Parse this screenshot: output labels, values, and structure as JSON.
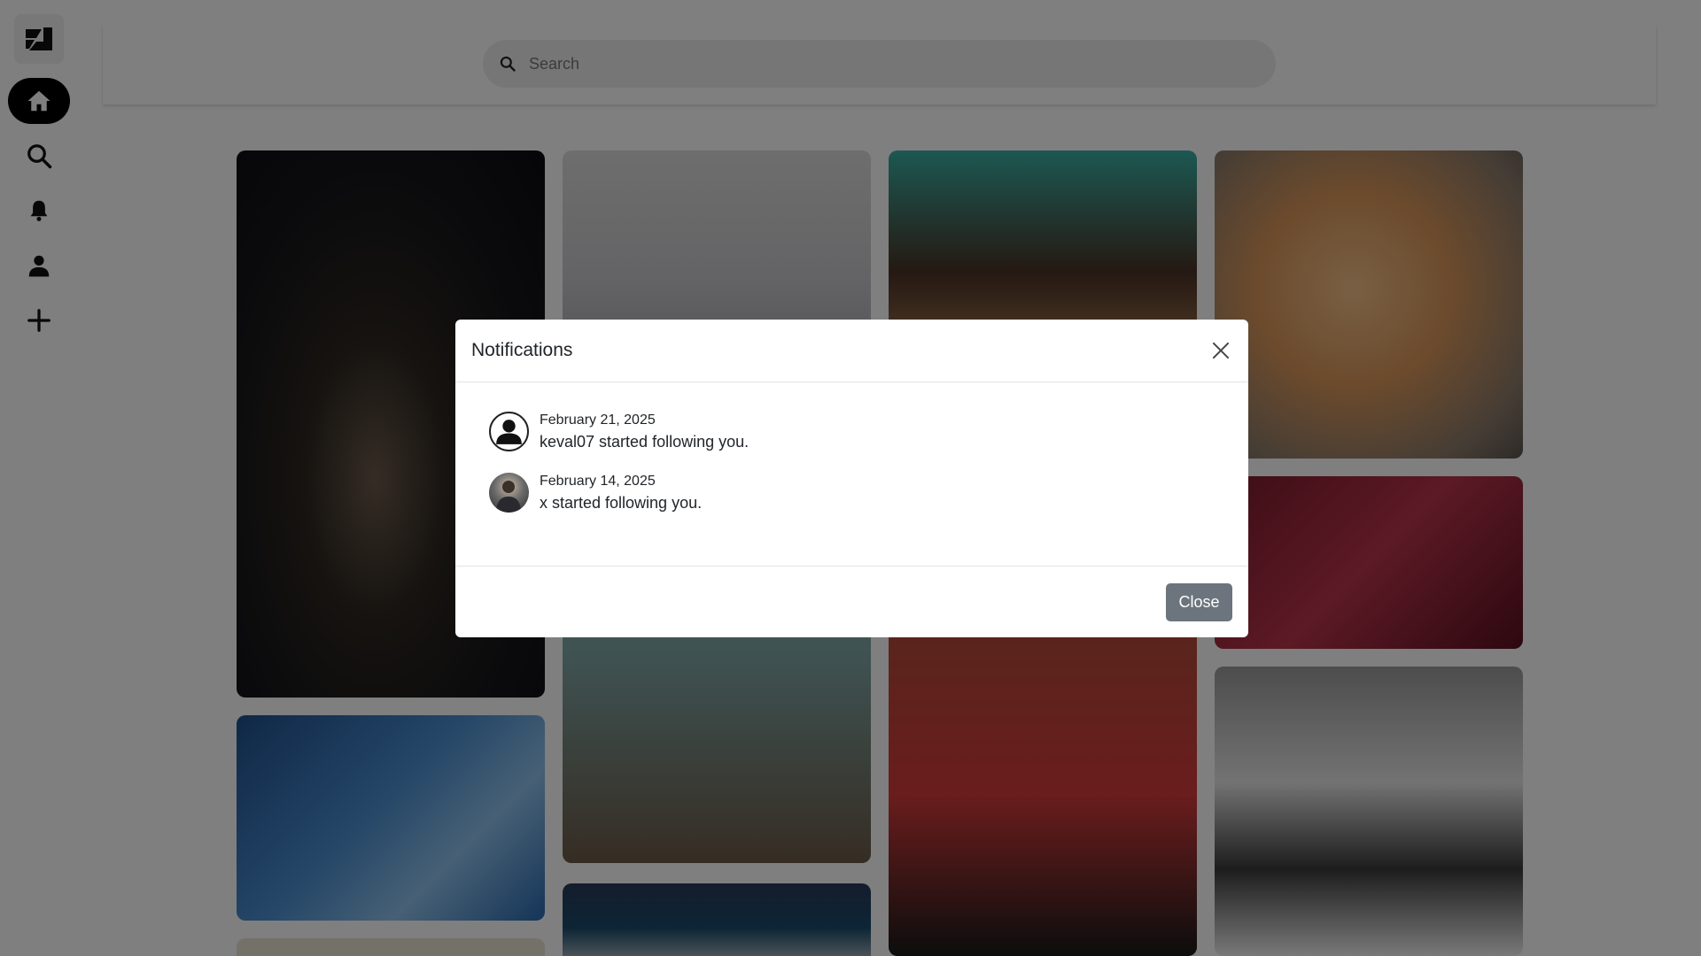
{
  "search": {
    "placeholder": "Search"
  },
  "sidebar": {
    "items": [
      {
        "name": "home",
        "icon": "home-icon",
        "active": true
      },
      {
        "name": "search",
        "icon": "search-icon",
        "active": false
      },
      {
        "name": "notifications",
        "icon": "bell-icon",
        "active": false
      },
      {
        "name": "profile",
        "icon": "user-icon",
        "active": false
      },
      {
        "name": "create",
        "icon": "plus-icon",
        "active": false
      }
    ]
  },
  "modal": {
    "title": "Notifications",
    "close_label": "Close",
    "notifications": [
      {
        "date": "February 21, 2025",
        "text": "keval07 started following you.",
        "avatar": "default-avatar-icon"
      },
      {
        "date": "February 14, 2025",
        "text": "x started following you.",
        "avatar": "user-photo"
      }
    ]
  },
  "colors": {
    "overlay": "#000000",
    "close_button": "#6c757d",
    "active_nav": "#000000"
  }
}
